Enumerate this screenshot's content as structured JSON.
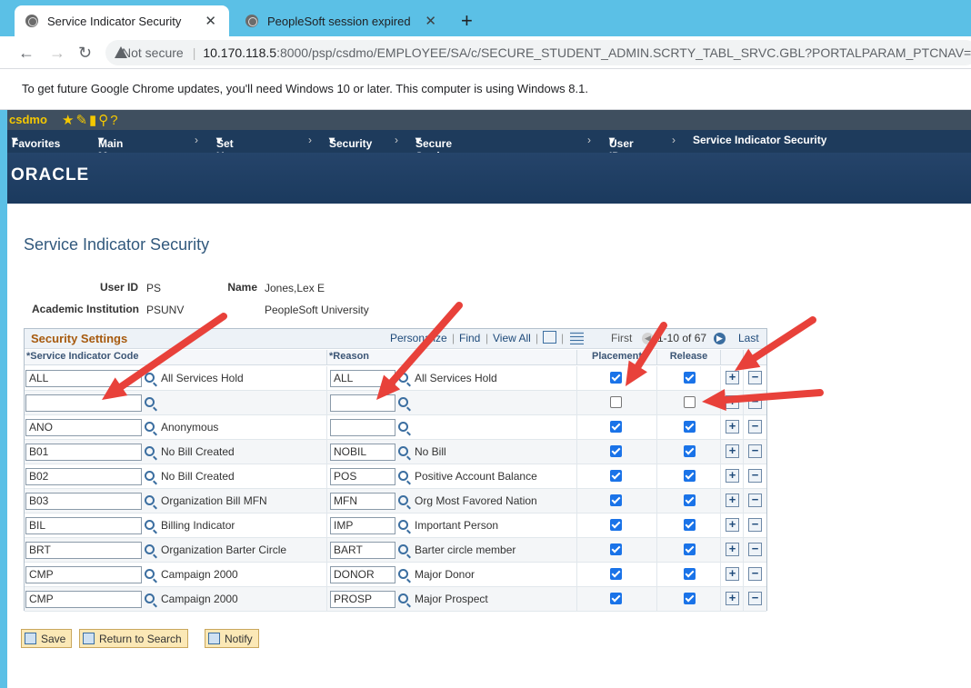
{
  "browser": {
    "tabs": [
      {
        "title": "Service Indicator Security",
        "active": true
      },
      {
        "title": "PeopleSoft session expired",
        "active": false
      }
    ],
    "address": {
      "security": "Not secure",
      "host": "10.170.118.5",
      "rest": ":8000/psp/csdmo/EMPLOYEE/SA/c/SECURE_STUDENT_ADMIN.SCRTY_TABL_SRVC.GBL?PORTALPARAM_PTCNAV=HC_SCRTY"
    },
    "infobar": "To get future Google Chrome updates, you'll need Windows 10 or later. This computer is using Windows 8.1."
  },
  "ps": {
    "system": "csdmo",
    "nav": {
      "favorites": "Favorites",
      "main_menu": "Main Menu",
      "crumbs": [
        "Set Up SACR",
        "Security",
        "Secure Student Administration",
        "User ID",
        "Service Indicator Security"
      ]
    },
    "logo": "ORACLE"
  },
  "page": {
    "title": "Service Indicator Security",
    "user_id_label": "User ID",
    "user_id": "PS",
    "name_label": "Name",
    "name": "Jones,Lex E",
    "inst_label": "Academic Institution",
    "inst": "PSUNV",
    "inst_name": "PeopleSoft University"
  },
  "grid": {
    "title": "Security Settings",
    "personalize": "Personalize",
    "find": "Find",
    "view_all": "View All",
    "first": "First",
    "range": "1-10 of 67",
    "last": "Last",
    "columns": {
      "code": "*Service Indicator Code",
      "reason": "*Reason",
      "placement": "Placement",
      "release": "Release"
    },
    "rows": [
      {
        "code": "ALL",
        "code_desc": "All Services Hold",
        "reason": "ALL",
        "reason_desc": "All Services Hold",
        "placement": true,
        "release": true
      },
      {
        "code": "",
        "code_desc": "",
        "reason": "",
        "reason_desc": "",
        "placement": false,
        "release": false
      },
      {
        "code": "ANO",
        "code_desc": "Anonymous",
        "reason": "",
        "reason_desc": "",
        "placement": true,
        "release": true
      },
      {
        "code": "B01",
        "code_desc": "No Bill Created",
        "reason": "NOBIL",
        "reason_desc": "No Bill",
        "placement": true,
        "release": true
      },
      {
        "code": "B02",
        "code_desc": "No Bill Created",
        "reason": "POS",
        "reason_desc": "Positive Account Balance",
        "placement": true,
        "release": true
      },
      {
        "code": "B03",
        "code_desc": "Organization Bill MFN",
        "reason": "MFN",
        "reason_desc": "Org Most Favored Nation",
        "placement": true,
        "release": true
      },
      {
        "code": "BIL",
        "code_desc": "Billing Indicator",
        "reason": "IMP",
        "reason_desc": "Important Person",
        "placement": true,
        "release": true
      },
      {
        "code": "BRT",
        "code_desc": "Organization Barter Circle",
        "reason": "BART",
        "reason_desc": "Barter circle member",
        "placement": true,
        "release": true
      },
      {
        "code": "CMP",
        "code_desc": "Campaign 2000",
        "reason": "DONOR",
        "reason_desc": "Major Donor",
        "placement": true,
        "release": true
      },
      {
        "code": "CMP",
        "code_desc": "Campaign 2000",
        "reason": "PROSP",
        "reason_desc": "Major Prospect",
        "placement": true,
        "release": true
      }
    ]
  },
  "buttons": {
    "save": "Save",
    "return": "Return to Search",
    "notify": "Notify"
  },
  "colors": {
    "annotation_arrow": "#e8413a",
    "checkbox": "#1a73e8",
    "nav_bg": "#1e3b5c",
    "grid_title": "#a75a0e"
  }
}
